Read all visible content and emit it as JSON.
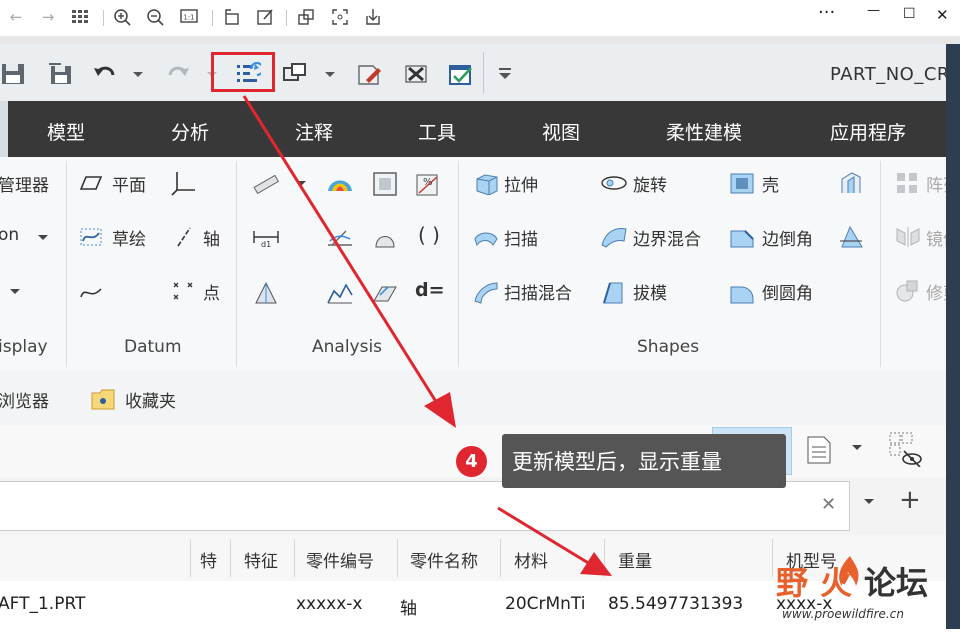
{
  "viewer": {
    "nav": [
      "back-icon",
      "forward-icon",
      "grid-icon"
    ],
    "tools": [
      "zoom-in-icon",
      "zoom-out-icon",
      "fit-icon",
      "rotate-icon",
      "edit-icon",
      "crop-icon",
      "fullscreen-icon",
      "download-icon"
    ],
    "window_controls": {
      "more": "···",
      "minimize": "—",
      "maximize": "☐",
      "close": "✕"
    }
  },
  "app": {
    "title": "PART_NO_CR",
    "tabs": [
      "模型",
      "分析",
      "注释",
      "工具",
      "视图",
      "柔性建模",
      "应用程序"
    ],
    "ribbon": {
      "left_partial": {
        "items": [
          "管理器",
          "on",
          "isplay"
        ]
      },
      "datum": {
        "items": [
          "平面",
          "轴",
          "点",
          "草绘"
        ],
        "label": "Datum"
      },
      "analysis": {
        "items": [
          "d="
        ],
        "label": "Analysis"
      },
      "shapes": {
        "items": [
          "拉伸",
          "旋转",
          "壳",
          "扫描",
          "边界混合",
          "边倒角",
          "扫描混合",
          "拔模",
          "倒圆角"
        ],
        "label": "Shapes"
      },
      "right_partial": {
        "items": [
          "阵列",
          "镜像",
          "修剪"
        ]
      }
    },
    "navigator": {
      "browser": "浏览器",
      "favorites": "收藏夹"
    },
    "table": {
      "headers": [
        "特",
        "特征",
        "零件编号",
        "零件名称",
        "材料",
        "重量",
        "机型号"
      ],
      "row": {
        "name": "AFT_1.PRT",
        "part_no": "xxxxx-x",
        "part_name": "轴",
        "material": "20CrMnTi",
        "weight": "85.5497731393",
        "model": "xxxx-x"
      }
    }
  },
  "annotation": {
    "step": "4",
    "tooltip": "更新模型后，显示重量",
    "accent": "#e0262f"
  },
  "watermark": {
    "cn": "野火论坛",
    "url": "www.proewildfire.cn"
  }
}
